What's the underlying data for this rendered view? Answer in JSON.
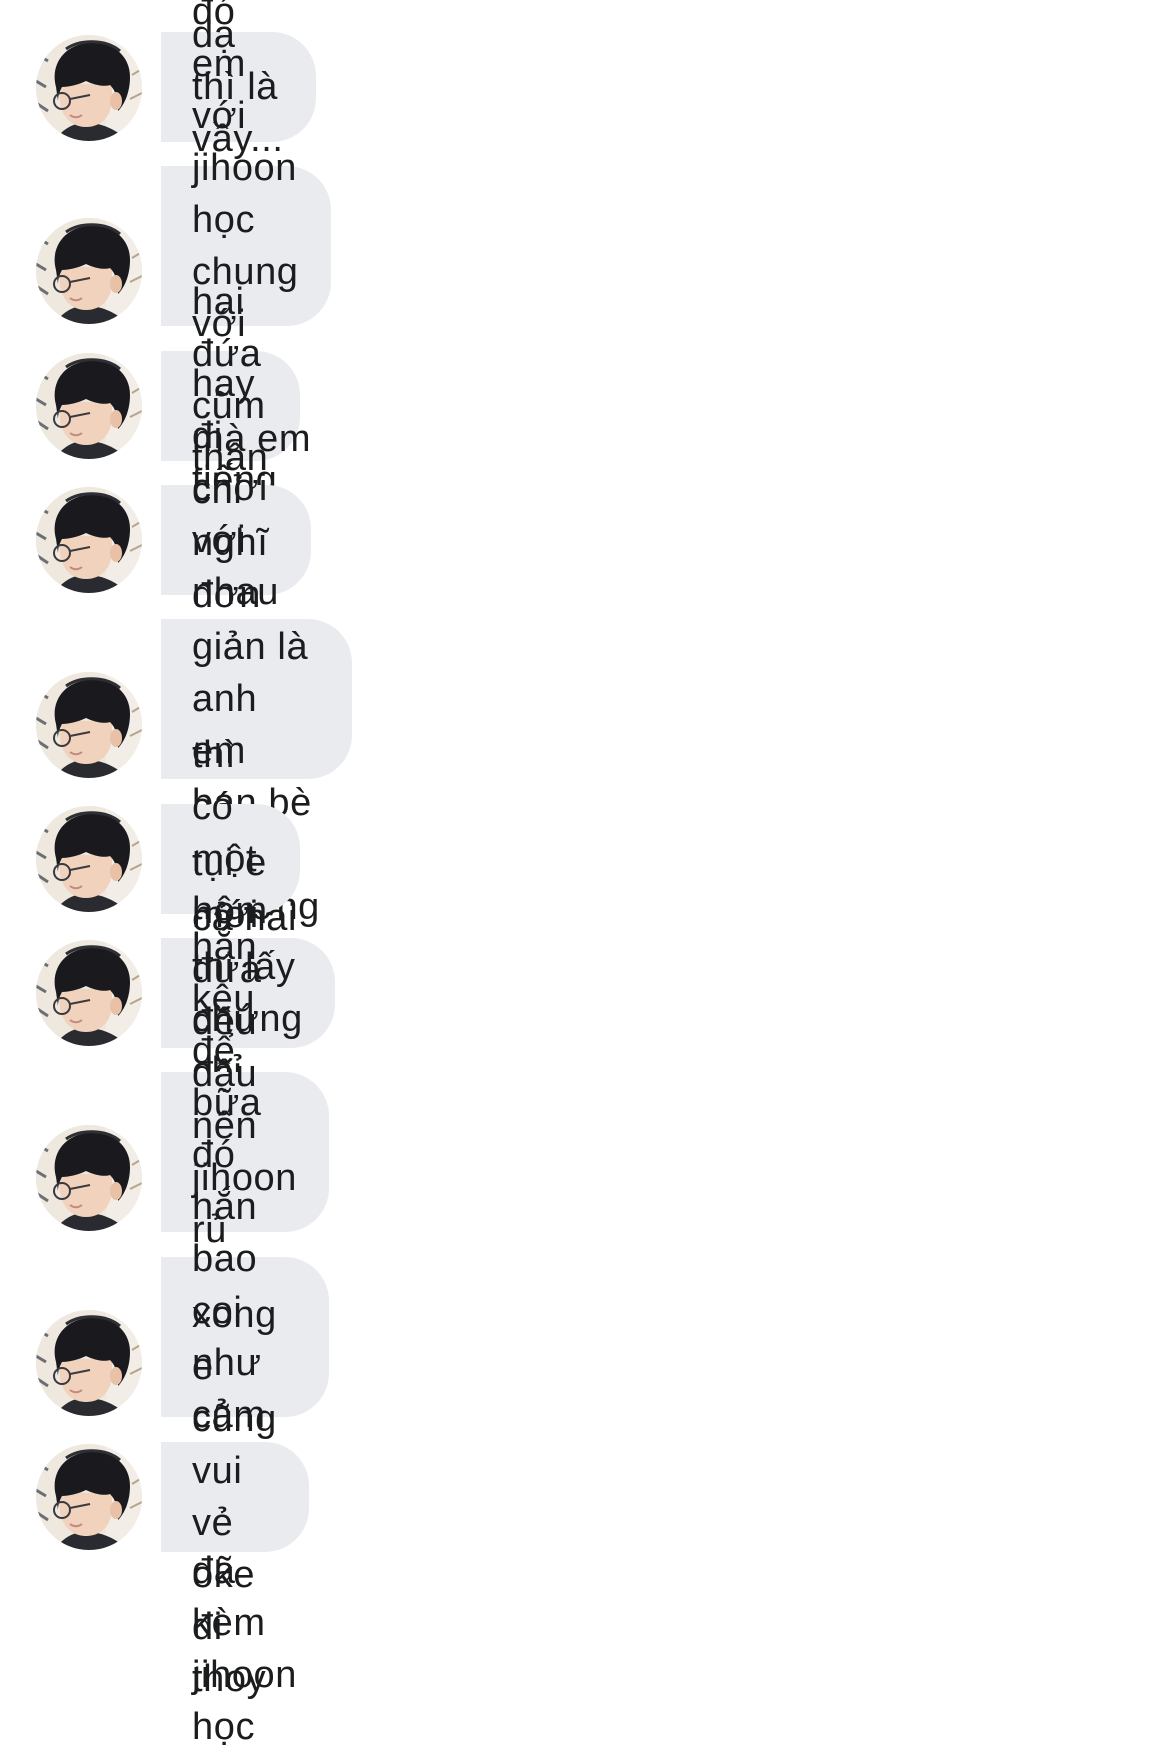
{
  "conversation": {
    "sender_avatar_icon": "user-avatar-photo",
    "bubble_color": "#e9ebef",
    "text_color": "#1b1c1e",
    "messages": [
      {
        "text": "dạ thì là vầy..."
      },
      {
        "text": "hồi đó em với jihoon học chung với\nnhau lớp tiếng anh"
      },
      {
        "text": "hai đứa cũm thân thân"
      },
      {
        "text": "hay đi chơi với nhau đồ đó"
      },
      {
        "text": "mà em chỉ nghĩ đơn giản là anh em\nbạn bè bình thường thui"
      },
      {
        "text": "thì có một hôm kia"
      },
      {
        "text": "tụi e mới thi lấy chứng chỉ xong"
      },
      {
        "text": "cả hai đứa đều đậu nên jihoon rủ\nem đi chơi nữa"
      },
      {
        "text": "hắn kêu để bữa đó hắn bao coi như\ncảm ơn em vì đã kèm jihoon học"
      },
      {
        "text": "xong e cũng vui vẻ oke đi thoy"
      }
    ]
  }
}
